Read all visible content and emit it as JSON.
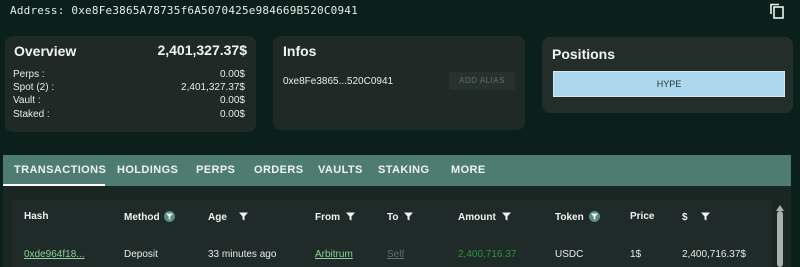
{
  "address": {
    "label": "Address: 0xe8Fe3865A78735f6A5070425e984669B520C0941"
  },
  "overview": {
    "title": "Overview",
    "total": "2,401,327.37$",
    "rows": [
      {
        "label": "Perps :",
        "value": "0.00$"
      },
      {
        "label": "Spot (2) :",
        "value": "2,401,327.37$"
      },
      {
        "label": "Vault :",
        "value": "0.00$"
      },
      {
        "label": "Staked :",
        "value": "0.00$"
      }
    ]
  },
  "infos": {
    "title": "Infos",
    "short_address": "0xe8Fe3865...520C0941",
    "alias_button": "ADD ALIAS"
  },
  "positions": {
    "title": "Positions",
    "items": [
      "HYPE"
    ]
  },
  "tabs": [
    "TRANSACTIONS",
    "HOLDINGS",
    "PERPS",
    "ORDERS",
    "VAULTS",
    "STAKING",
    "MORE"
  ],
  "table": {
    "headers": [
      "Hash",
      "Method",
      "Age",
      "From",
      "To",
      "Amount",
      "Token",
      "Price",
      "$"
    ],
    "rows": [
      {
        "hash": "0xde964f18...",
        "method": "Deposit",
        "age": "33 minutes ago",
        "from": "Arbitrum",
        "to": "Self",
        "amount": "2,400,716.37",
        "token": "USDC",
        "price": "1$",
        "usd": "2,400,716.37$"
      }
    ]
  },
  "colors": {
    "background": "#0b1f1b",
    "card": "#1f2a27",
    "tabbar": "#4f7c71",
    "position_chip": "#acd7ec",
    "amount_green": "#2f8f3c"
  }
}
